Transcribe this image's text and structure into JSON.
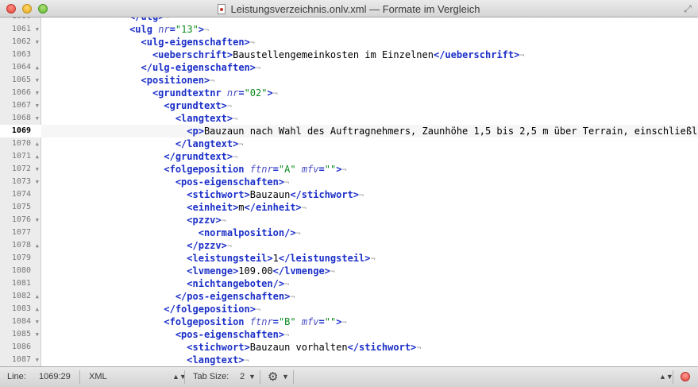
{
  "window": {
    "title": "Leistungsverzeichnis.onlv.xml — Formate im Vergleich"
  },
  "icons": {
    "close": "close-button",
    "minimize": "minimize-button",
    "zoom": "zoom-button",
    "document": "xml-document-icon",
    "fullscreen": "fullscreen-icon",
    "gear": "gear-icon",
    "record": "record-icon"
  },
  "colors": {
    "tag": "#1b2fc8",
    "attribute": "#4a4ec0",
    "value": "#0a8a1c",
    "invisible": "#9a9a9a"
  },
  "editor": {
    "current_line": "1069",
    "lines": [
      {
        "num": "1060",
        "fold": "",
        "indent": 7,
        "tokens": [
          {
            "t": "tag",
            "v": "</ulg>"
          },
          {
            "t": "inv",
            "v": "¬"
          }
        ]
      },
      {
        "num": "1061",
        "fold": "▼",
        "indent": 7,
        "tokens": [
          {
            "t": "tag",
            "v": "<ulg "
          },
          {
            "t": "attr",
            "v": "nr"
          },
          {
            "t": "tag",
            "v": "="
          },
          {
            "t": "val",
            "v": "\"13\""
          },
          {
            "t": "tag",
            "v": ">"
          },
          {
            "t": "inv",
            "v": "¬"
          }
        ]
      },
      {
        "num": "1062",
        "fold": "▼",
        "indent": 8,
        "tokens": [
          {
            "t": "tag",
            "v": "<ulg-eigenschaften>"
          },
          {
            "t": "inv",
            "v": "¬"
          }
        ]
      },
      {
        "num": "1063",
        "fold": "",
        "indent": 9,
        "tokens": [
          {
            "t": "tag",
            "v": "<ueberschrift>"
          },
          {
            "t": "text",
            "v": "Baustellengemeinkosten im Einzelnen"
          },
          {
            "t": "tag",
            "v": "</ueberschrift>"
          },
          {
            "t": "inv",
            "v": "¬"
          }
        ]
      },
      {
        "num": "1064",
        "fold": "▲",
        "indent": 8,
        "tokens": [
          {
            "t": "tag",
            "v": "</ulg-eigenschaften>"
          },
          {
            "t": "inv",
            "v": "¬"
          }
        ]
      },
      {
        "num": "1065",
        "fold": "▼",
        "indent": 8,
        "tokens": [
          {
            "t": "tag",
            "v": "<positionen>"
          },
          {
            "t": "inv",
            "v": "¬"
          }
        ]
      },
      {
        "num": "1066",
        "fold": "▼",
        "indent": 9,
        "tokens": [
          {
            "t": "tag",
            "v": "<grundtextnr "
          },
          {
            "t": "attr",
            "v": "nr"
          },
          {
            "t": "tag",
            "v": "="
          },
          {
            "t": "val",
            "v": "\"02\""
          },
          {
            "t": "tag",
            "v": ">"
          },
          {
            "t": "inv",
            "v": "¬"
          }
        ]
      },
      {
        "num": "1067",
        "fold": "▼",
        "indent": 10,
        "tokens": [
          {
            "t": "tag",
            "v": "<grundtext>"
          },
          {
            "t": "inv",
            "v": "¬"
          }
        ]
      },
      {
        "num": "1068",
        "fold": "▼",
        "indent": 11,
        "tokens": [
          {
            "t": "tag",
            "v": "<langtext>"
          },
          {
            "t": "inv",
            "v": "¬"
          }
        ]
      },
      {
        "num": "1069",
        "fold": "",
        "indent": 12,
        "tokens": [
          {
            "t": "tag",
            "v": "<p>"
          },
          {
            "t": "text",
            "v": "Bauzaun nach Wahl des Auftragnehmers, Zaunhöhe 1,5 bis 2,5 m über Terrain, einschließlich"
          }
        ]
      },
      {
        "num": "1070",
        "fold": "▲",
        "indent": 11,
        "tokens": [
          {
            "t": "tag",
            "v": "</langtext>"
          },
          {
            "t": "inv",
            "v": "¬"
          }
        ]
      },
      {
        "num": "1071",
        "fold": "▲",
        "indent": 10,
        "tokens": [
          {
            "t": "tag",
            "v": "</grundtext>"
          },
          {
            "t": "inv",
            "v": "¬"
          }
        ]
      },
      {
        "num": "1072",
        "fold": "▼",
        "indent": 10,
        "tokens": [
          {
            "t": "tag",
            "v": "<folgeposition "
          },
          {
            "t": "attr",
            "v": "ftnr"
          },
          {
            "t": "tag",
            "v": "="
          },
          {
            "t": "val",
            "v": "\"A\""
          },
          {
            "t": "text",
            "v": " "
          },
          {
            "t": "attr",
            "v": "mfv"
          },
          {
            "t": "tag",
            "v": "="
          },
          {
            "t": "val",
            "v": "\"\""
          },
          {
            "t": "tag",
            "v": ">"
          },
          {
            "t": "inv",
            "v": "¬"
          }
        ]
      },
      {
        "num": "1073",
        "fold": "▼",
        "indent": 11,
        "tokens": [
          {
            "t": "tag",
            "v": "<pos-eigenschaften>"
          },
          {
            "t": "inv",
            "v": "¬"
          }
        ]
      },
      {
        "num": "1074",
        "fold": "",
        "indent": 12,
        "tokens": [
          {
            "t": "tag",
            "v": "<stichwort>"
          },
          {
            "t": "text",
            "v": "Bauzaun"
          },
          {
            "t": "tag",
            "v": "</stichwort>"
          },
          {
            "t": "inv",
            "v": "¬"
          }
        ]
      },
      {
        "num": "1075",
        "fold": "",
        "indent": 12,
        "tokens": [
          {
            "t": "tag",
            "v": "<einheit>"
          },
          {
            "t": "text",
            "v": "m"
          },
          {
            "t": "tag",
            "v": "</einheit>"
          },
          {
            "t": "inv",
            "v": "¬"
          }
        ]
      },
      {
        "num": "1076",
        "fold": "▼",
        "indent": 12,
        "tokens": [
          {
            "t": "tag",
            "v": "<pzzv>"
          },
          {
            "t": "inv",
            "v": "¬"
          }
        ]
      },
      {
        "num": "1077",
        "fold": "",
        "indent": 13,
        "tokens": [
          {
            "t": "tag",
            "v": "<normalposition/>"
          },
          {
            "t": "inv",
            "v": "¬"
          }
        ]
      },
      {
        "num": "1078",
        "fold": "▲",
        "indent": 12,
        "tokens": [
          {
            "t": "tag",
            "v": "</pzzv>"
          },
          {
            "t": "inv",
            "v": "¬"
          }
        ]
      },
      {
        "num": "1079",
        "fold": "",
        "indent": 12,
        "tokens": [
          {
            "t": "tag",
            "v": "<leistungsteil>"
          },
          {
            "t": "text",
            "v": "1"
          },
          {
            "t": "tag",
            "v": "</leistungsteil>"
          },
          {
            "t": "inv",
            "v": "¬"
          }
        ]
      },
      {
        "num": "1080",
        "fold": "",
        "indent": 12,
        "tokens": [
          {
            "t": "tag",
            "v": "<lvmenge>"
          },
          {
            "t": "text",
            "v": "109.00"
          },
          {
            "t": "tag",
            "v": "</lvmenge>"
          },
          {
            "t": "inv",
            "v": "¬"
          }
        ]
      },
      {
        "num": "1081",
        "fold": "",
        "indent": 12,
        "tokens": [
          {
            "t": "tag",
            "v": "<nichtangeboten/>"
          },
          {
            "t": "inv",
            "v": "¬"
          }
        ]
      },
      {
        "num": "1082",
        "fold": "▲",
        "indent": 11,
        "tokens": [
          {
            "t": "tag",
            "v": "</pos-eigenschaften>"
          },
          {
            "t": "inv",
            "v": "¬"
          }
        ]
      },
      {
        "num": "1083",
        "fold": "▲",
        "indent": 10,
        "tokens": [
          {
            "t": "tag",
            "v": "</folgeposition>"
          },
          {
            "t": "inv",
            "v": "¬"
          }
        ]
      },
      {
        "num": "1084",
        "fold": "▼",
        "indent": 10,
        "tokens": [
          {
            "t": "tag",
            "v": "<folgeposition "
          },
          {
            "t": "attr",
            "v": "ftnr"
          },
          {
            "t": "tag",
            "v": "="
          },
          {
            "t": "val",
            "v": "\"B\""
          },
          {
            "t": "text",
            "v": " "
          },
          {
            "t": "attr",
            "v": "mfv"
          },
          {
            "t": "tag",
            "v": "="
          },
          {
            "t": "val",
            "v": "\"\""
          },
          {
            "t": "tag",
            "v": ">"
          },
          {
            "t": "inv",
            "v": "¬"
          }
        ]
      },
      {
        "num": "1085",
        "fold": "▼",
        "indent": 11,
        "tokens": [
          {
            "t": "tag",
            "v": "<pos-eigenschaften>"
          },
          {
            "t": "inv",
            "v": "¬"
          }
        ]
      },
      {
        "num": "1086",
        "fold": "",
        "indent": 12,
        "tokens": [
          {
            "t": "tag",
            "v": "<stichwort>"
          },
          {
            "t": "text",
            "v": "Bauzaun vorhalten"
          },
          {
            "t": "tag",
            "v": "</stichwort>"
          },
          {
            "t": "inv",
            "v": "¬"
          }
        ]
      },
      {
        "num": "1087",
        "fold": "▼",
        "indent": 12,
        "tokens": [
          {
            "t": "tag",
            "v": "<langtext>"
          },
          {
            "t": "inv",
            "v": "¬"
          }
        ]
      }
    ]
  },
  "statusbar": {
    "line_label": "Line:",
    "line_value": "1069:29",
    "language": "XML",
    "tab_size_label": "Tab Size:",
    "tab_size_value": "2"
  }
}
